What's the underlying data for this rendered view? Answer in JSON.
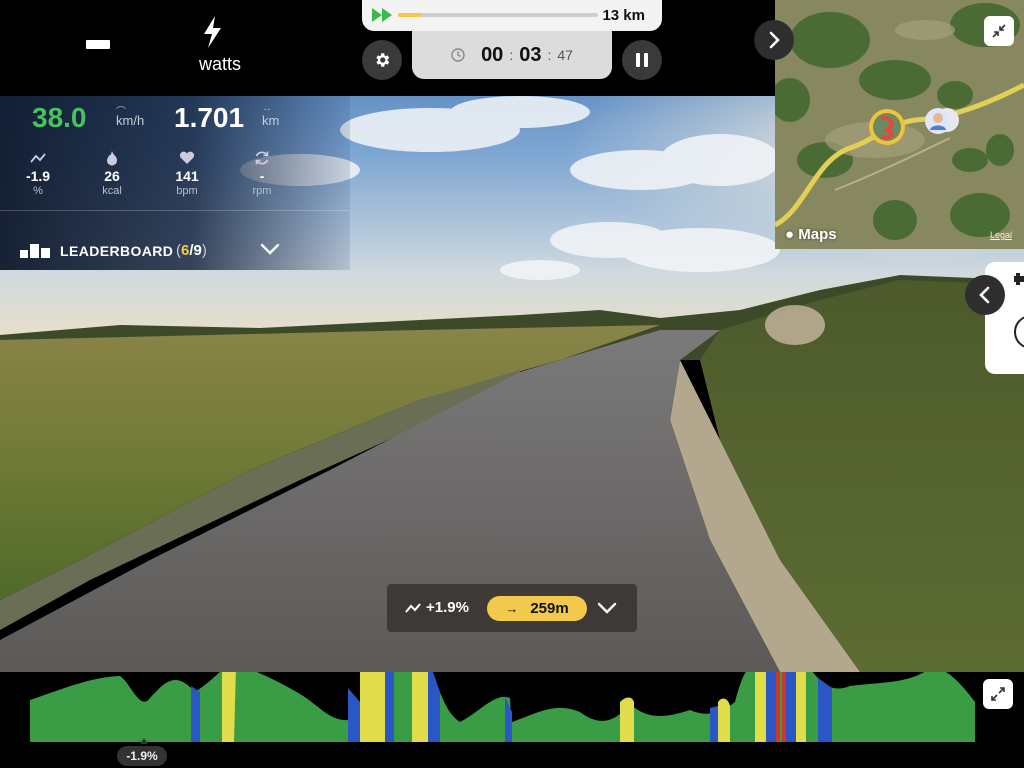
{
  "top_bar": {
    "power_label": "watts"
  },
  "progress": {
    "route_distance": "13 km",
    "fraction": 0.12
  },
  "timer": {
    "hours": "00",
    "minutes": "03",
    "seconds": "47",
    "sep1": ":",
    "sep2": ":"
  },
  "stats": {
    "speed": "38.0",
    "speed_unit": "km/h",
    "distance": "1.701",
    "distance_unit": "km",
    "metrics": [
      {
        "icon": "slope-icon",
        "value": "-1.9",
        "unit": "%"
      },
      {
        "icon": "flame-icon",
        "value": "26",
        "unit": "kcal"
      },
      {
        "icon": "heart-icon",
        "value": "141",
        "unit": "bpm"
      },
      {
        "icon": "cadence-icon",
        "value": "-",
        "unit": "rpm"
      }
    ]
  },
  "leaderboard": {
    "label": "LEADERBOARD",
    "open": "(",
    "position": "6",
    "slash": "/",
    "total": "9",
    "close": ")"
  },
  "map": {
    "provider": "Maps",
    "legal": "Legal"
  },
  "grade_box": {
    "slope": "+1.9%",
    "arrow": "→",
    "distance": "259m"
  },
  "elevation": {
    "current_grade": "-1.9%"
  },
  "colors": {
    "speed_green": "#46c35a",
    "accent_yellow": "#f2c94c",
    "profile_green": "#3a9c45",
    "profile_yellow": "#e0dc4a",
    "profile_blue": "#2a56c6",
    "profile_red": "#d2352c"
  }
}
